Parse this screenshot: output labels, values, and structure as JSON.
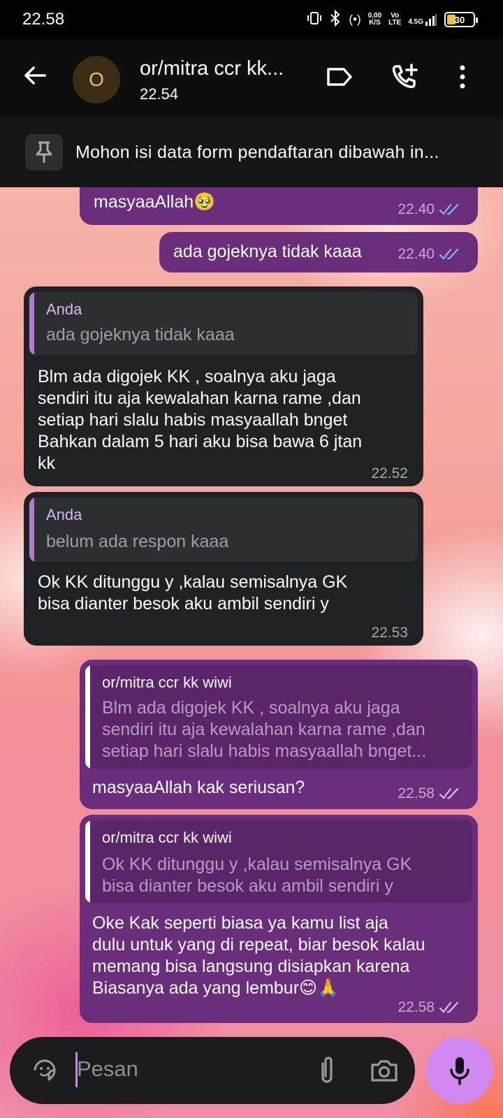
{
  "status_bar": {
    "time": "22.58",
    "net_speed_value": "0,00",
    "net_speed_unit": "K/S",
    "volte_top": "Vo",
    "volte_bottom": "LTE",
    "network": "4.5G",
    "battery": "30"
  },
  "header": {
    "avatar_letter": "O",
    "title": "or/mitra ccr kk...",
    "subtitle": "22.54"
  },
  "pinned": {
    "text": "Mohon isi data form pendaftaran dibawah in..."
  },
  "messages": [
    {
      "text": "masyaaAllah🥹",
      "time": "22.40"
    },
    {
      "text": "ada gojeknya tidak kaaa",
      "time": "22.40"
    },
    {
      "quote_name": "Anda",
      "quote_text": "ada gojeknya tidak kaaa",
      "lines": [
        "Blm ada digojek KK , soalnya aku jaga",
        "sendiri itu aja kewalahan karna rame ,dan",
        "setiap hari slalu habis masyaallah bnget",
        "Bahkan dalam 5 hari aku bisa bawa 6 jtan",
        "kk"
      ],
      "time": "22.52"
    },
    {
      "quote_name": "Anda",
      "quote_text": "belum ada respon kaaa",
      "lines": [
        "Ok KK ditunggu y ,kalau semisalnya GK",
        "bisa dianter besok aku ambil sendiri y"
      ],
      "time": "22.53"
    },
    {
      "quote_name": "or/mitra ccr kk wiwi",
      "quote_lines": [
        "Blm ada digojek KK , soalnya aku jaga",
        "sendiri itu aja kewalahan karna rame ,dan",
        "setiap hari slalu habis masyaallah bnget..."
      ],
      "text": "masyaaAllah kak seriusan?",
      "time": "22.58"
    },
    {
      "quote_name": "or/mitra ccr kk wiwi",
      "quote_lines": [
        "Ok KK ditunggu y ,kalau semisalnya GK",
        "bisa dianter besok aku ambil sendiri y"
      ],
      "lines": [
        "Oke Kak seperti biasa ya kamu list aja",
        "dulu untuk yang di repeat, biar besok kalau",
        "memang bisa langsung disiapkan karena",
        "Biasanya ada yang lembur😊🙏"
      ],
      "time": "22.58"
    }
  ],
  "input": {
    "placeholder": "Pesan"
  },
  "colors": {
    "outgoing_bubble": "#6b2e7d",
    "incoming_bubble": "#1f2224",
    "read_ticks": "#7fb8ff",
    "mic_button": "#d089f0"
  }
}
